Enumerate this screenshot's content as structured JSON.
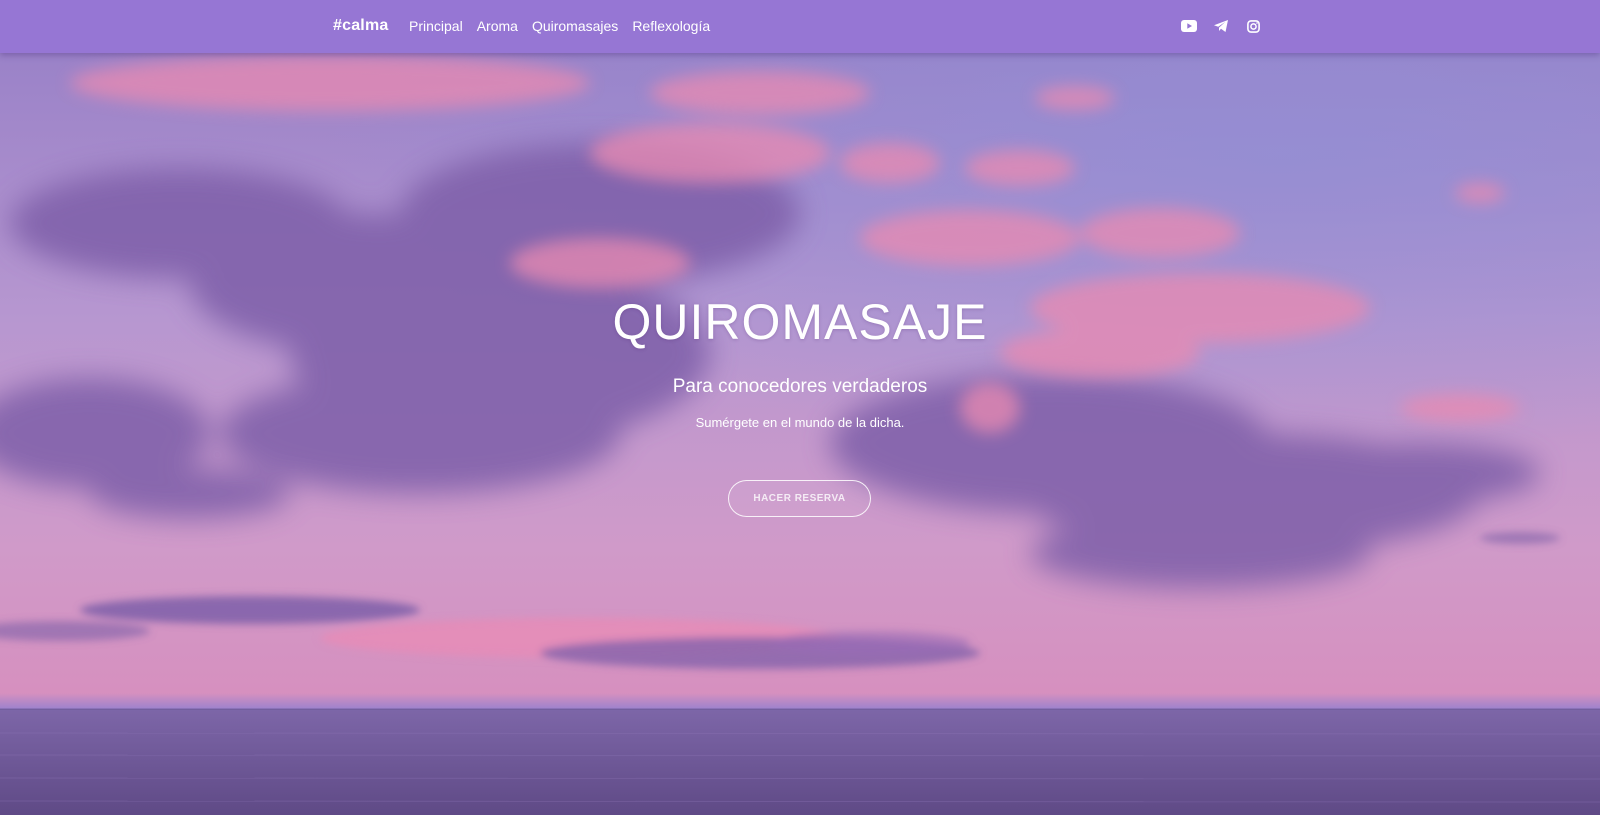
{
  "navbar": {
    "brand": "#calma",
    "links": [
      {
        "label": "Principal"
      },
      {
        "label": "Aroma"
      },
      {
        "label": "Quiromasajes"
      },
      {
        "label": "Reflexología"
      }
    ],
    "social": [
      "youtube-icon",
      "telegram-icon",
      "instagram-icon"
    ],
    "background_color": "#9676d4"
  },
  "hero": {
    "title": "QUIROMASAJE",
    "subtitle": "Para conocedores verdaderos",
    "text": "Sumérgete en el mundo de la dicha.",
    "cta_label": "HACER RESERVA"
  },
  "colors": {
    "sky_top": "#8e82c9",
    "sky_mid": "#c29dd0",
    "sky_horizon": "#d894c4",
    "sea": "#6f5698",
    "cloud_pink": "#e58fb5",
    "cloud_purple": "#7c5ea8"
  }
}
